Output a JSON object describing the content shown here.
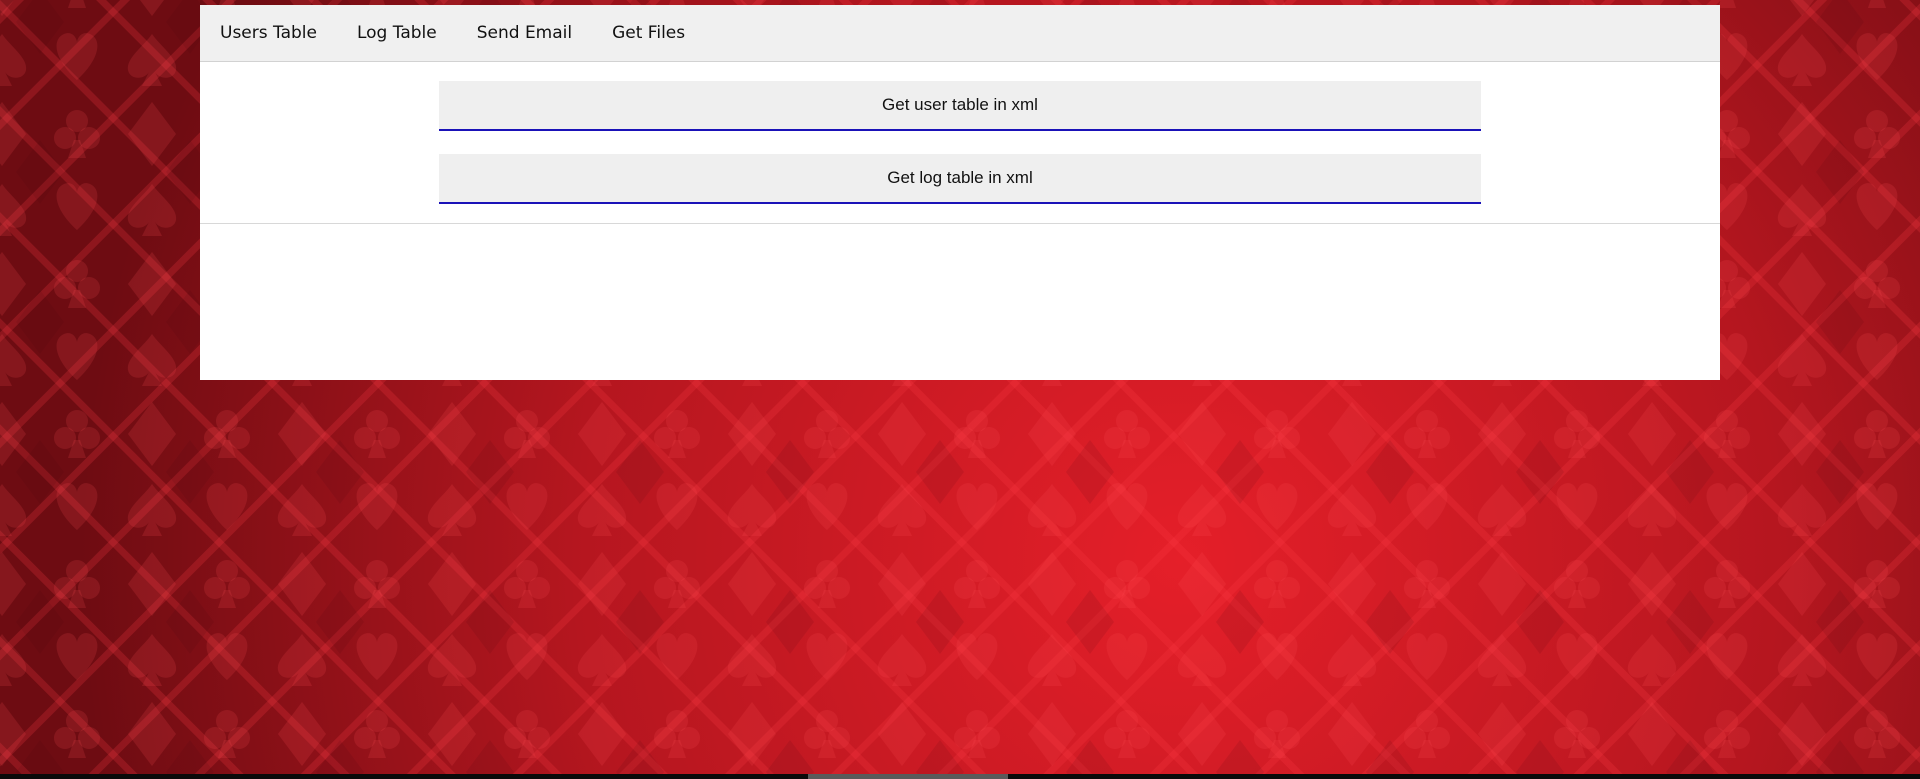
{
  "colors": {
    "background_dark": "#7a0f16",
    "background_light": "#e21e28",
    "panel": "#ffffff",
    "nav_bar": "#f0f0f0",
    "button_fill": "#efefef",
    "button_underline": "#1a12b8"
  },
  "nav": {
    "items": [
      {
        "label": "Users Table"
      },
      {
        "label": "Log Table"
      },
      {
        "label": "Send Email"
      },
      {
        "label": "Get Files"
      }
    ]
  },
  "actions": {
    "user_xml_label": "Get user table in xml",
    "log_xml_label": "Get log table in xml"
  }
}
